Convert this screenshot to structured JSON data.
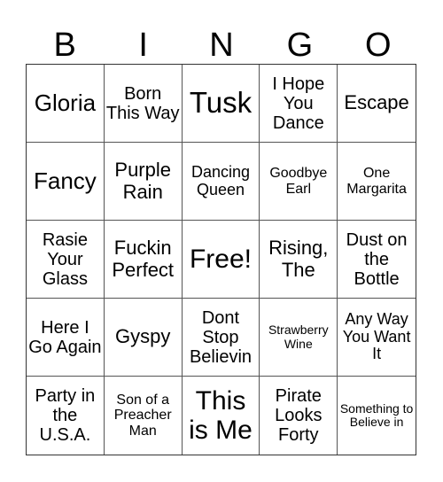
{
  "header": {
    "letters": [
      "B",
      "I",
      "N",
      "G",
      "O"
    ]
  },
  "cells": [
    "Gloria",
    "Born This Way",
    "Tusk",
    "I Hope You Dance",
    "Escape",
    "Fancy",
    "Purple Rain",
    "Dancing Queen",
    "Goodbye Earl",
    "One Margarita",
    "Rasie Your Glass",
    "Fuckin Perfect",
    "Free!",
    "Rising, The",
    "Dust on the Bottle",
    "Here I Go Again",
    "Gyspy",
    "Dont Stop Believin",
    "Strawberry Wine",
    "Any Way You Want It",
    "Party in the U.S.A.",
    "Son of a Preacher Man",
    "This is Me",
    "Pirate Looks Forty",
    "Something to Believe in"
  ]
}
